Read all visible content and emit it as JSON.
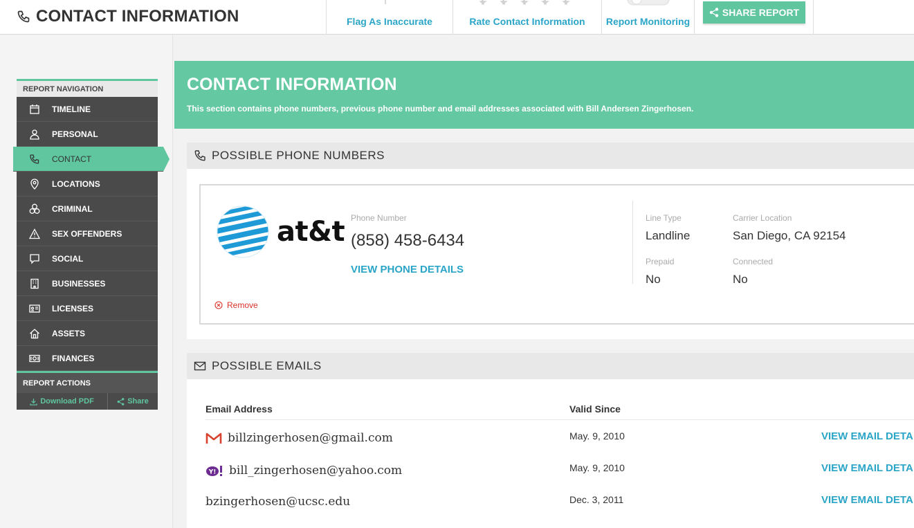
{
  "header": {
    "title": "CONTACT INFORMATION",
    "actions": {
      "flag": "Flag As Inaccurate",
      "rate": "Rate Contact Information",
      "monitor": "Report Monitoring"
    },
    "share_label": "SHARE REPORT"
  },
  "nav": {
    "heading": "REPORT NAVIGATION",
    "items": [
      {
        "label": "TIMELINE",
        "icon": "calendar-icon"
      },
      {
        "label": "PERSONAL",
        "icon": "user-icon"
      },
      {
        "label": "CONTACT",
        "icon": "phone-icon"
      },
      {
        "label": "LOCATIONS",
        "icon": "map-pin-icon"
      },
      {
        "label": "CRIMINAL",
        "icon": "handcuffs-icon"
      },
      {
        "label": "SEX OFFENDERS",
        "icon": "warning-icon"
      },
      {
        "label": "SOCIAL",
        "icon": "chat-icon"
      },
      {
        "label": "BUSINESSES",
        "icon": "building-icon"
      },
      {
        "label": "LICENSES",
        "icon": "id-card-icon"
      },
      {
        "label": "ASSETS",
        "icon": "house-icon"
      },
      {
        "label": "FINANCES",
        "icon": "money-icon"
      }
    ],
    "active": "CONTACT",
    "actions_heading": "REPORT ACTIONS",
    "download_label": "Download PDF",
    "share_label": "Share"
  },
  "hero": {
    "title": "CONTACT INFORMATION",
    "description": "This section contains phone numbers, previous phone number and email addresses associated with Bill Andersen Zingerhosen."
  },
  "phones": {
    "heading": "POSSIBLE PHONE NUMBERS",
    "card": {
      "carrier_logo_text": "at&t",
      "phone_label": "Phone Number",
      "phone_value": "(858) 458-6434",
      "details_link": "VIEW PHONE DETAILS",
      "line_type_label": "Line Type",
      "line_type_value": "Landline",
      "carrier_location_label": "Carrier Location",
      "carrier_location_value": "San Diego, CA 92154",
      "prepaid_label": "Prepaid",
      "prepaid_value": "No",
      "connected_label": "Connected",
      "connected_value": "No",
      "remove_label": "Remove"
    }
  },
  "emails": {
    "heading": "POSSIBLE EMAILS",
    "columns": {
      "address": "Email Address",
      "valid_since": "Valid Since"
    },
    "rows": [
      {
        "address": "billzingerhosen@gmail.com",
        "provider": "gmail-icon",
        "valid_since": "May. 9, 2010",
        "link": "VIEW EMAIL DETA"
      },
      {
        "address": "bill_zingerhosen@yahoo.com",
        "provider": "yahoo-icon",
        "valid_since": "May. 9, 2010",
        "link": "VIEW EMAIL DETA"
      },
      {
        "address": "bzingerhosen@ucsc.edu",
        "provider": "",
        "valid_since": "Dec. 3, 2011",
        "link": "VIEW EMAIL DETA"
      }
    ]
  },
  "colors": {
    "accent": "#5fc6a0",
    "link": "#2aa5c8",
    "nav_bg": "#4a4a4a",
    "danger": "#d9302a"
  }
}
